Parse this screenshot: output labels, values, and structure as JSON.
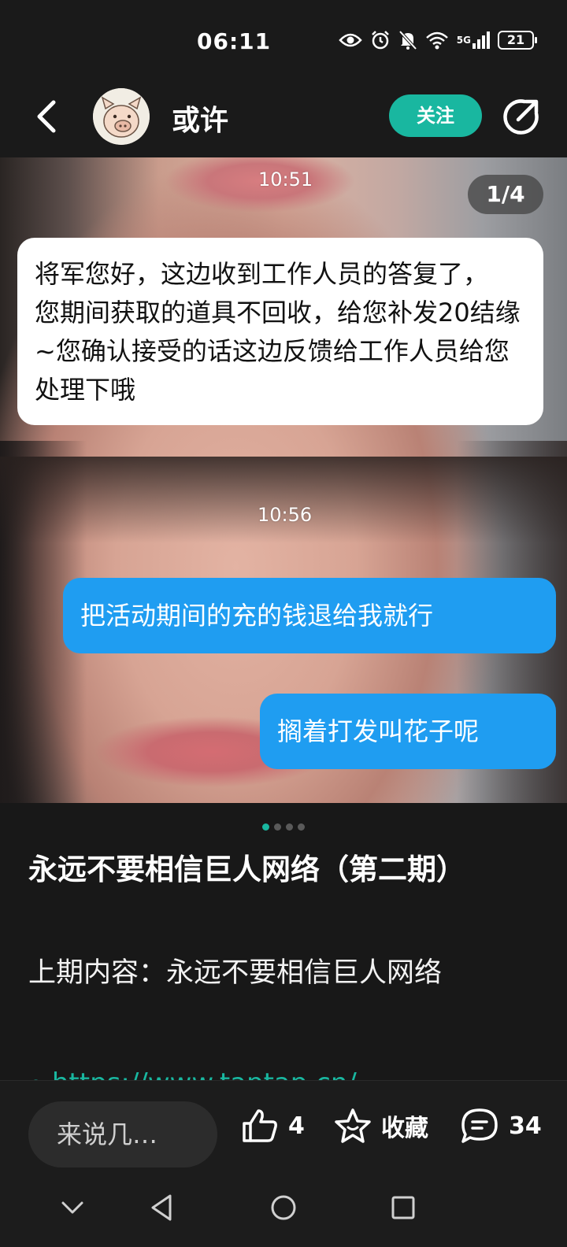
{
  "status_bar": {
    "time": "06:11",
    "network": "5G",
    "battery": "21"
  },
  "header": {
    "username": "或许",
    "follow_label": "关注",
    "accent_color": "#19b7a0"
  },
  "carousel": {
    "page_counter": "1/4",
    "messages": [
      {
        "time": "10:51",
        "side": "left",
        "text": "将军您好，这边收到工作人员的答复了，\n您期间获取的道具不回收，给您补发20结缘~您确认接受的话这边反馈给工作人员给您处理下哦"
      },
      {
        "time": "10:56",
        "side": "right",
        "text": "把活动期间的充的钱退给我就行"
      },
      {
        "time": "",
        "side": "right",
        "text": "搁着打发叫花子呢"
      }
    ],
    "dots_total": 4,
    "dots_active": 1
  },
  "post": {
    "title": "永远不要相信巨人网络（第二期）",
    "body": "上期内容：永远不要相信巨人网络",
    "link": "https://www.taptap.cn/"
  },
  "bottom_bar": {
    "comment_placeholder": "来说几…",
    "like_count": "4",
    "collect_label": "收藏",
    "comment_count": "34"
  },
  "icons": {
    "back": "chevron-left-icon",
    "share": "share-icon",
    "like": "thumbs-up-icon",
    "collect": "star-icon",
    "comment": "comment-bubble-icon"
  }
}
